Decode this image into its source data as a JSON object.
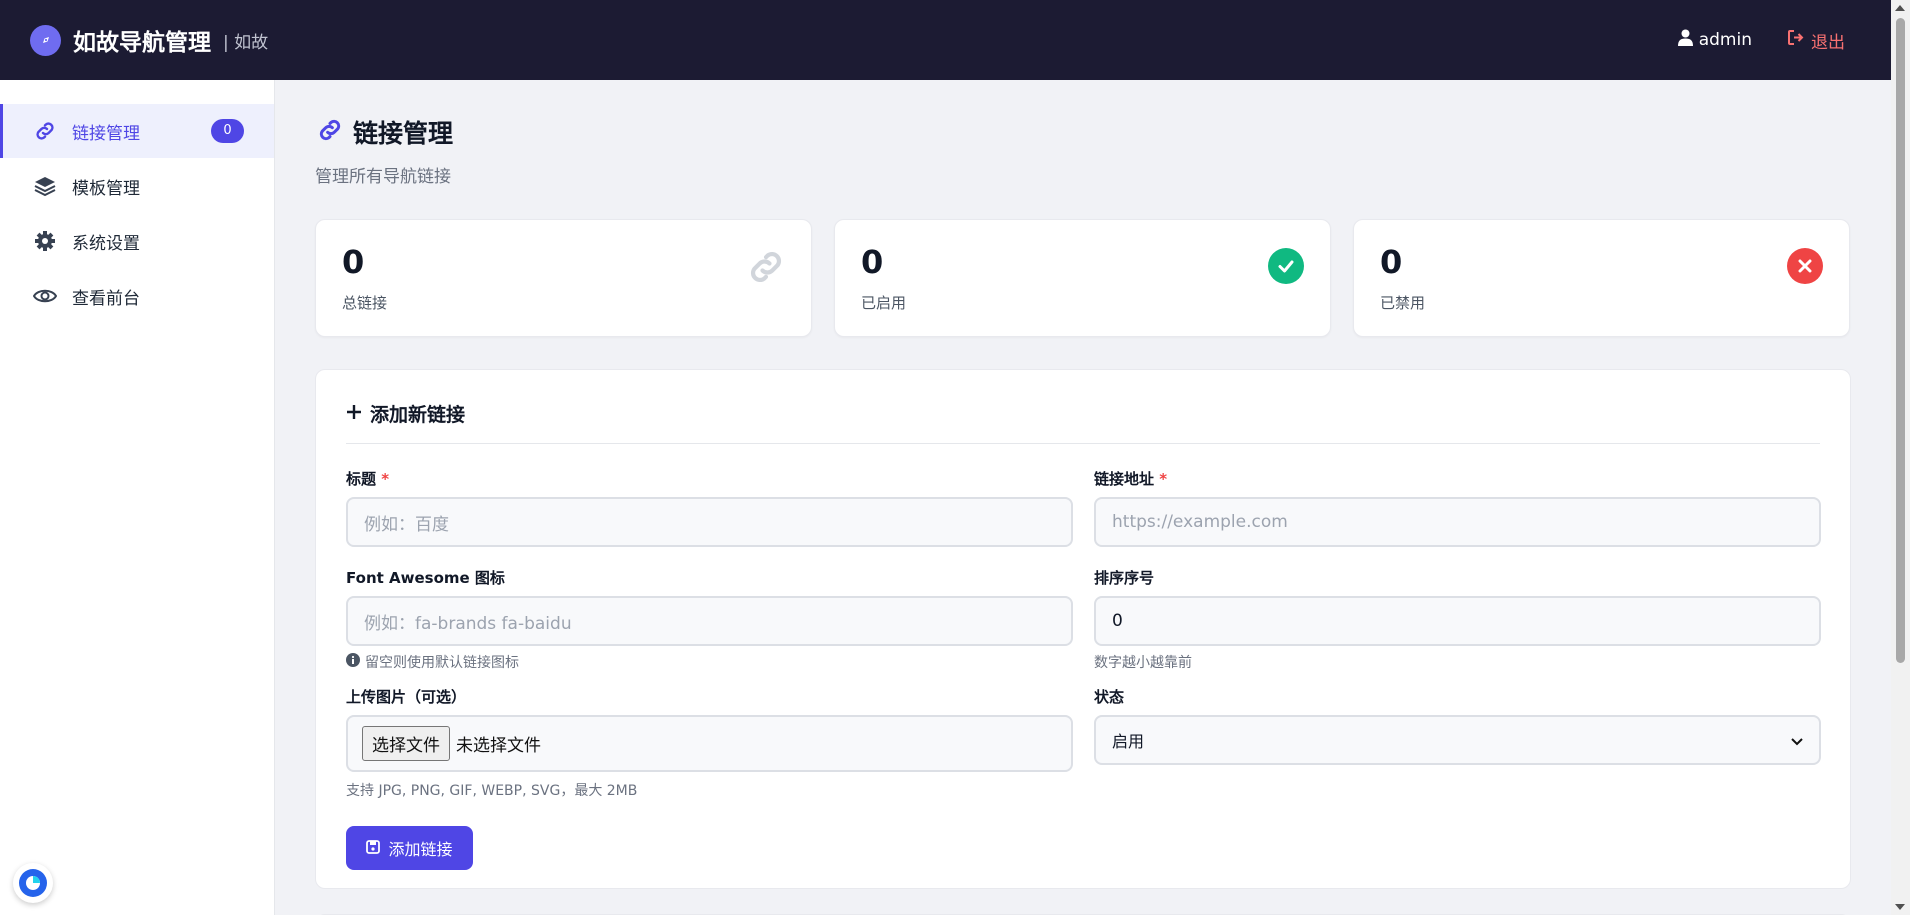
{
  "app": {
    "title": "如故导航管理",
    "subtitle": "| 如故",
    "user": "admin",
    "logout": "退出"
  },
  "sidebar": {
    "items": [
      {
        "label": "链接管理",
        "icon": "link-icon",
        "badge": "0",
        "active": true
      },
      {
        "label": "模板管理",
        "icon": "layers-icon"
      },
      {
        "label": "系统设置",
        "icon": "gear-icon"
      },
      {
        "label": "查看前台",
        "icon": "eye-icon"
      }
    ]
  },
  "page": {
    "title": "链接管理",
    "subtitle": "管理所有导航链接"
  },
  "stats": [
    {
      "value": "0",
      "label": "总链接",
      "icon": "link-icon"
    },
    {
      "value": "0",
      "label": "已启用",
      "icon": "check-circle-icon",
      "color": "#10b981"
    },
    {
      "value": "0",
      "label": "已禁用",
      "icon": "x-circle-icon",
      "color": "#ef4444"
    }
  ],
  "form": {
    "title": "添加新链接",
    "title_label": "标题",
    "title_placeholder": "例如：百度",
    "url_label": "链接地址",
    "url_placeholder": "https://example.com",
    "icon_label": "Font Awesome 图标",
    "icon_placeholder": "例如：fa-brands fa-baidu",
    "icon_hint": "留空则使用默认链接图标",
    "order_label": "排序序号",
    "order_value": "0",
    "order_hint": "数字越小越靠前",
    "image_label": "上传图片（可选）",
    "file_button": "选择文件",
    "file_status": "未选择文件",
    "image_hint": "支持 JPG, PNG, GIF, WEBP, SVG，最大 2MB",
    "status_label": "状态",
    "status_value": "启用",
    "required_mark": "*",
    "submit_label": "添加链接"
  },
  "colors": {
    "accent": "#4f46e5",
    "navbar": "#1c1b33",
    "success": "#10b981",
    "danger": "#ef4444"
  }
}
